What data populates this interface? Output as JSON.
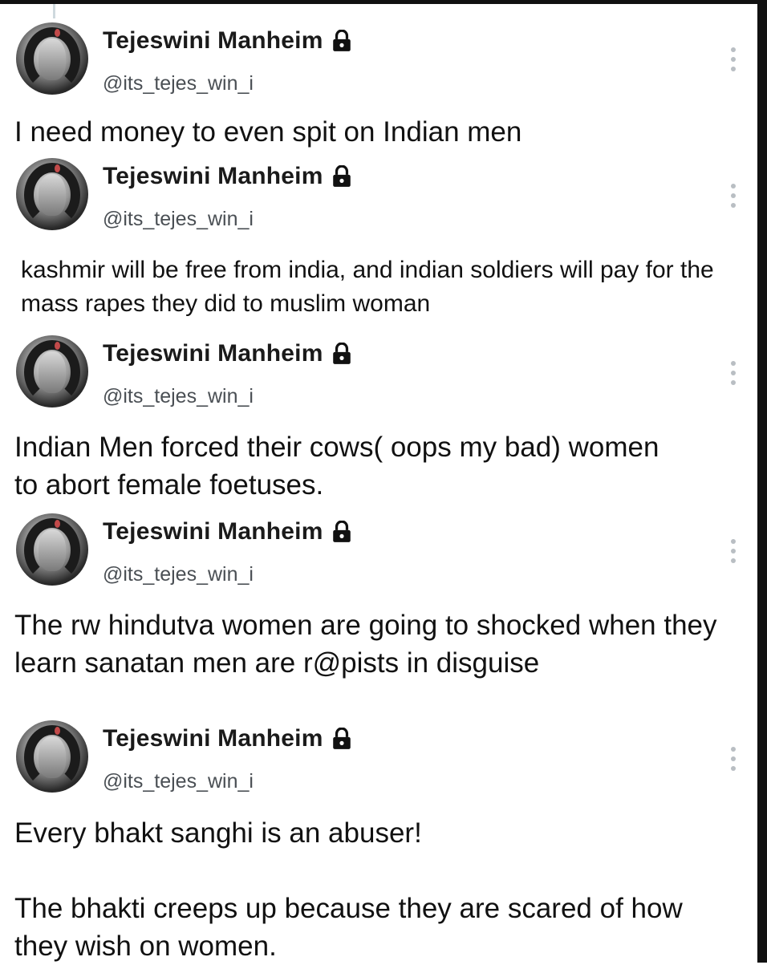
{
  "tweets": [
    {
      "display_name": "Tejeswini Manheim",
      "handle": "@its_tejes_win_i",
      "text": "I need money to even spit on Indian men"
    },
    {
      "display_name": "Tejeswini Manheim",
      "handle": "@its_tejes_win_i",
      "text": "kashmir will be free from india, and indian soldiers will pay for the mass rapes they did to muslim woman"
    },
    {
      "display_name": "Tejeswini Manheim",
      "handle": "@its_tejes_win_i",
      "text": "Indian Men forced their cows( oops my bad) women to abort female foetuses."
    },
    {
      "display_name": "Tejeswini Manheim",
      "handle": "@its_tejes_win_i",
      "text": "The rw hindutva women are going to shocked when they learn sanatan men are r@pists in disguise"
    },
    {
      "display_name": "Tejeswini Manheim",
      "handle": "@its_tejes_win_i",
      "text": "Every bhakt sanghi is an abuser!\n\nThe bhakti creeps up because they are scared of how they wish on women."
    }
  ],
  "icons": {
    "lock": "lock-icon",
    "more": "more-vertical-icon"
  },
  "colors": {
    "text": "#0f1419",
    "handle": "#4a4f54",
    "divider": "#cfd9de"
  }
}
